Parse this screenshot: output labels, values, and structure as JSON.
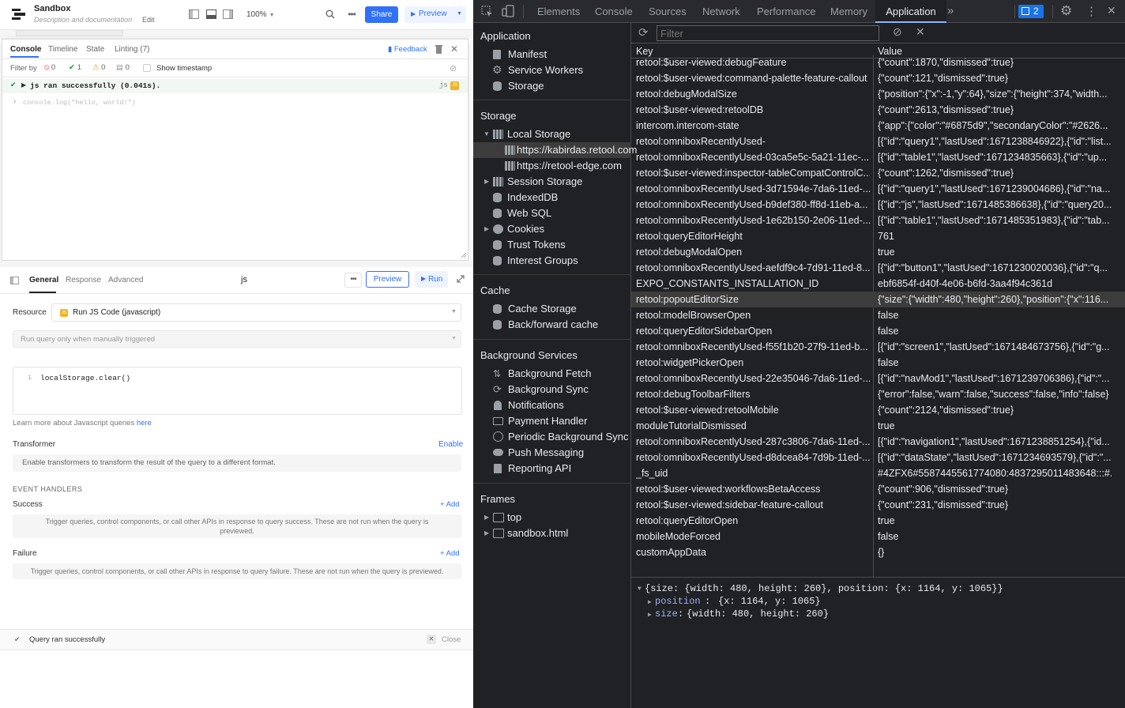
{
  "app": {
    "title": "Sandbox",
    "subtitle": "Description and documentation",
    "edit_label": "Edit",
    "zoom": "100%",
    "share_label": "Share",
    "preview_label": "Preview",
    "console": {
      "tabs": [
        "Console",
        "Timeline",
        "State",
        "Linting (7)"
      ],
      "feedback_label": "Feedback",
      "filter_label": "Filter by",
      "counts": {
        "errors": "0",
        "success": "1",
        "warnings": "0",
        "info": "0"
      },
      "show_timestamp_label": "Show timestamp",
      "log_message": "js ran successfully (0.041s).",
      "log_tag": "js",
      "input_placeholder": "console.log(\"hello, world!\")"
    },
    "query": {
      "tabs": [
        "General",
        "Response",
        "Advanced"
      ],
      "name": "js",
      "preview_label": "Preview",
      "run_label": "Run",
      "resource_label": "Resource",
      "resource_value": "Run JS Code (javascript)",
      "trigger_value": "Run query only when manually triggered",
      "code_line_number": "1",
      "code": "localStorage.clear()",
      "learn_more": "Learn more about Javascript queries",
      "learn_more_link": "here",
      "transformer_label": "Transformer",
      "transformer_enable": "Enable",
      "transformer_desc": "Enable transformers to transform the result of the query to a different format.",
      "event_handlers_label": "EVENT HANDLERS",
      "success_label": "Success",
      "success_add": "+ Add",
      "success_desc": "Trigger queries, control components, or call other APIs in response to query success. These are not run when the query is previewed.",
      "failure_label": "Failure",
      "failure_add": "+ Add",
      "failure_desc": "Trigger queries, control components, or call other APIs in response to query failure. These are not run when the query is previewed."
    },
    "status": {
      "message": "Query ran successfully",
      "close_label": "Close"
    }
  },
  "devtools": {
    "tabs": [
      "Elements",
      "Console",
      "Sources",
      "Network",
      "Performance",
      "Memory",
      "Application"
    ],
    "issues_count": "2",
    "sidebar": {
      "application_header": "Application",
      "application_items": [
        "Manifest",
        "Service Workers",
        "Storage"
      ],
      "storage_header": "Storage",
      "local_storage": "Local Storage",
      "local_origins": [
        "https://kabirdas.retool.com",
        "https://retool-edge.com"
      ],
      "storage_items": [
        "Session Storage",
        "IndexedDB",
        "Web SQL",
        "Cookies",
        "Trust Tokens",
        "Interest Groups"
      ],
      "cache_header": "Cache",
      "cache_items": [
        "Cache Storage",
        "Back/forward cache"
      ],
      "bg_header": "Background Services",
      "bg_items": [
        "Background Fetch",
        "Background Sync",
        "Notifications",
        "Payment Handler",
        "Periodic Background Sync",
        "Push Messaging",
        "Reporting API"
      ],
      "frames_header": "Frames",
      "frames_items": [
        "top",
        "sandbox.html"
      ]
    },
    "filter_placeholder": "Filter",
    "table": {
      "key_header": "Key",
      "value_header": "Value",
      "selected_index": 15,
      "rows": [
        {
          "k": "retool:$user-viewed:debugFeature",
          "v": "{\"count\":1870,\"dismissed\":true}"
        },
        {
          "k": "retool:$user-viewed:command-palette-feature-callout",
          "v": "{\"count\":121,\"dismissed\":true}"
        },
        {
          "k": "retool:debugModalSize",
          "v": "{\"position\":{\"x\":-1,\"y\":64},\"size\":{\"height\":374,\"width..."
        },
        {
          "k": "retool:$user-viewed:retoolDB",
          "v": "{\"count\":2613,\"dismissed\":true}"
        },
        {
          "k": "intercom.intercom-state",
          "v": "{\"app\":{\"color\":\"#6875d9\",\"secondaryColor\":\"#2626..."
        },
        {
          "k": "retool:omniboxRecentlyUsed-",
          "v": "[{\"id\":\"query1\",\"lastUsed\":1671238846922},{\"id\":\"list..."
        },
        {
          "k": "retool:omniboxRecentlyUsed-03ca5e5c-5a21-11ec-...",
          "v": "[{\"id\":\"table1\",\"lastUsed\":1671234835663},{\"id\":\"up..."
        },
        {
          "k": "retool:$user-viewed:inspector-tableCompatControlC...",
          "v": "{\"count\":1262,\"dismissed\":true}"
        },
        {
          "k": "retool:omniboxRecentlyUsed-3d71594e-7da6-11ed-...",
          "v": "[{\"id\":\"query1\",\"lastUsed\":1671239004686},{\"id\":\"na..."
        },
        {
          "k": "retool:omniboxRecentlyUsed-b9def380-ff8d-11eb-a...",
          "v": "[{\"id\":\"js\",\"lastUsed\":1671485386638},{\"id\":\"query20..."
        },
        {
          "k": "retool:omniboxRecentlyUsed-1e62b150-2e06-11ed-...",
          "v": "[{\"id\":\"table1\",\"lastUsed\":1671485351983},{\"id\":\"tab..."
        },
        {
          "k": "retool:queryEditorHeight",
          "v": "761"
        },
        {
          "k": "retool:debugModalOpen",
          "v": "true"
        },
        {
          "k": "retool:omniboxRecentlyUsed-aefdf9c4-7d91-11ed-8...",
          "v": "[{\"id\":\"button1\",\"lastUsed\":1671230020036},{\"id\":\"q..."
        },
        {
          "k": "EXPO_CONSTANTS_INSTALLATION_ID",
          "v": "ebf6854f-d40f-4e06-b6fd-3aa4f94c361d"
        },
        {
          "k": "retool:popoutEditorSize",
          "v": "{\"size\":{\"width\":480,\"height\":260},\"position\":{\"x\":116..."
        },
        {
          "k": "retool:modelBrowserOpen",
          "v": "false"
        },
        {
          "k": "retool:queryEditorSidebarOpen",
          "v": "false"
        },
        {
          "k": "retool:omniboxRecentlyUsed-f55f1b20-27f9-11ed-b...",
          "v": "[{\"id\":\"screen1\",\"lastUsed\":1671484673756},{\"id\":\"g..."
        },
        {
          "k": "retool:widgetPickerOpen",
          "v": "false"
        },
        {
          "k": "retool:omniboxRecentlyUsed-22e35046-7da6-11ed-...",
          "v": "[{\"id\":\"navMod1\",\"lastUsed\":1671239706386},{\"id\":\"..."
        },
        {
          "k": "retool:debugToolbarFilters",
          "v": "{\"error\":false,\"warn\":false,\"success\":false,\"info\":false}"
        },
        {
          "k": "retool:$user-viewed:retoolMobile",
          "v": "{\"count\":2124,\"dismissed\":true}"
        },
        {
          "k": "moduleTutorialDismissed",
          "v": "true"
        },
        {
          "k": "retool:omniboxRecentlyUsed-287c3806-7da6-11ed-...",
          "v": "[{\"id\":\"navigation1\",\"lastUsed\":1671238851254},{\"id..."
        },
        {
          "k": "retool:omniboxRecentlyUsed-d8dcea84-7d9b-11ed-...",
          "v": "[{\"id\":\"dataState\",\"lastUsed\":1671234693579},{\"id\":\"..."
        },
        {
          "k": "_fs_uid",
          "v": "#4ZFX6#5587445561774080:4837295011483648:::#..."
        },
        {
          "k": "retool:$user-viewed:workflowsBetaAccess",
          "v": "{\"count\":906,\"dismissed\":true}"
        },
        {
          "k": "retool:$user-viewed:sidebar-feature-callout",
          "v": "{\"count\":231,\"dismissed\":true}"
        },
        {
          "k": "retool:queryEditorOpen",
          "v": "true"
        },
        {
          "k": "mobileModeForced",
          "v": "false"
        },
        {
          "k": "customAppData",
          "v": "{}"
        }
      ]
    },
    "preview": {
      "line1": "{size: {width: 480, height: 260}, position: {x: 1164, y: 1065}}",
      "line2_key": "position",
      "line2_val": "{x: 1164, y: 1065}",
      "line3_key": "size",
      "line3_val": "{width: 480, height: 260}"
    }
  }
}
